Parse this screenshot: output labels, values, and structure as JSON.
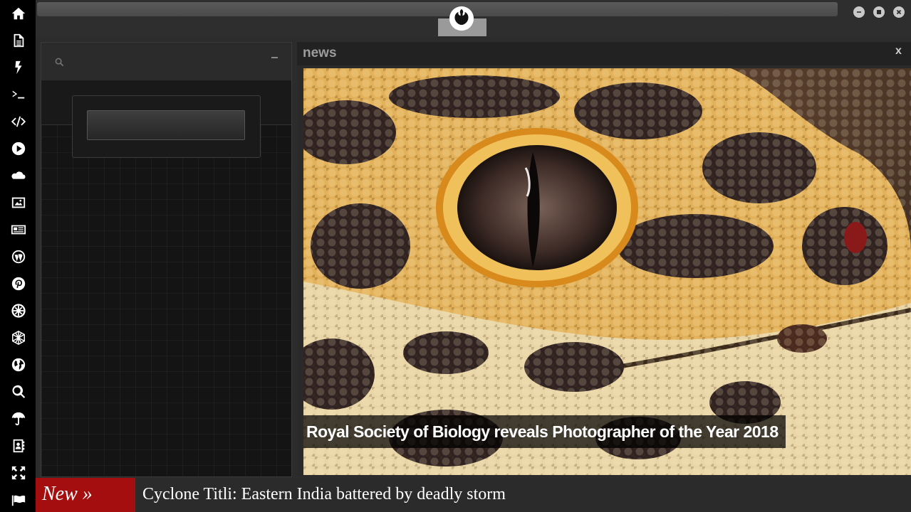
{
  "sidebar": {
    "icons": [
      "home-icon",
      "document-icon",
      "bolt-icon",
      "terminal-icon",
      "code-icon",
      "play-icon",
      "cloud-icon",
      "image-icon",
      "newspaper-icon",
      "wordpress-icon",
      "pinterest-icon",
      "galactic-empire-icon",
      "hexagon-mesh-icon",
      "globe-icon",
      "search-icon",
      "umbrella-icon",
      "contacts-icon",
      "expand-icon",
      "flag-icon"
    ]
  },
  "topbar": {
    "logo_icon": "rebel-alliance-icon",
    "window_controls": [
      "minimize-icon",
      "maximize-icon",
      "close-icon"
    ]
  },
  "left_panel": {
    "search_icon": "search-icon",
    "minimize_icon": "minimize-icon",
    "input_value": ""
  },
  "news": {
    "title": "news",
    "close_label": "x",
    "caption": "Royal Society of Biology reveals Photographer of the Year 2018"
  },
  "ticker": {
    "label": "New »",
    "headline": "Cyclone Titli: Eastern India battered by deadly storm",
    "label_color": "#a40e0e"
  }
}
